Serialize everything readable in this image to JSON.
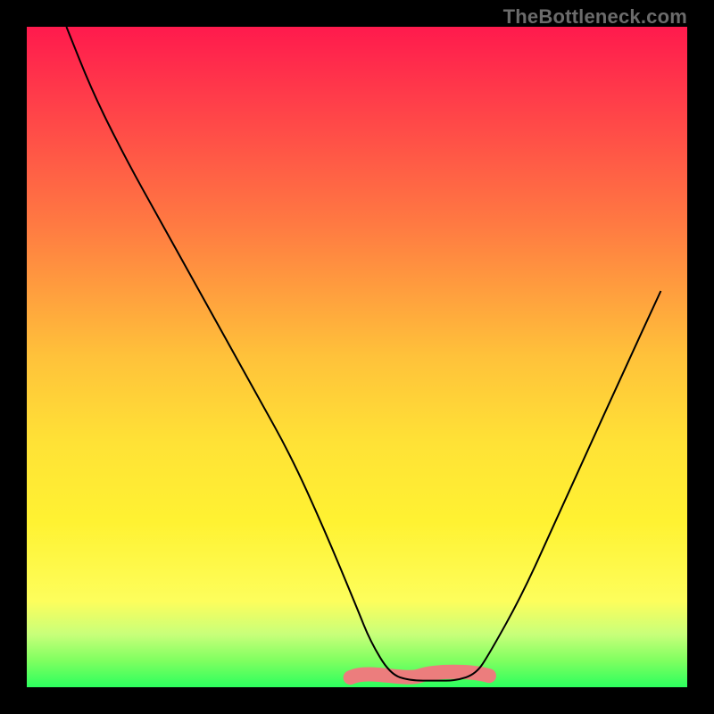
{
  "watermark": "TheBottleneck.com",
  "chart_data": {
    "type": "line",
    "title": "",
    "xlabel": "",
    "ylabel": "",
    "xlim": [
      0,
      100
    ],
    "ylim": [
      0,
      100
    ],
    "grid": false,
    "series": [
      {
        "name": "curve",
        "x": [
          6,
          10,
          15,
          20,
          25,
          30,
          35,
          40,
          45,
          50,
          52,
          55,
          58,
          62,
          65,
          68,
          70,
          75,
          80,
          85,
          90,
          96
        ],
        "y": [
          100,
          90,
          80,
          71,
          62,
          53,
          44,
          35,
          24,
          12,
          7,
          2,
          1,
          1,
          1,
          2,
          5,
          14,
          25,
          36,
          47,
          60
        ]
      }
    ],
    "highlight_band": {
      "name": "bottom-band",
      "x_range": [
        49,
        70
      ],
      "y": 2,
      "color": "#ec7d7d"
    },
    "background_gradient": {
      "top": "#ff1a4d",
      "mid": "#ffe236",
      "bottom": "#2cff5e"
    }
  }
}
